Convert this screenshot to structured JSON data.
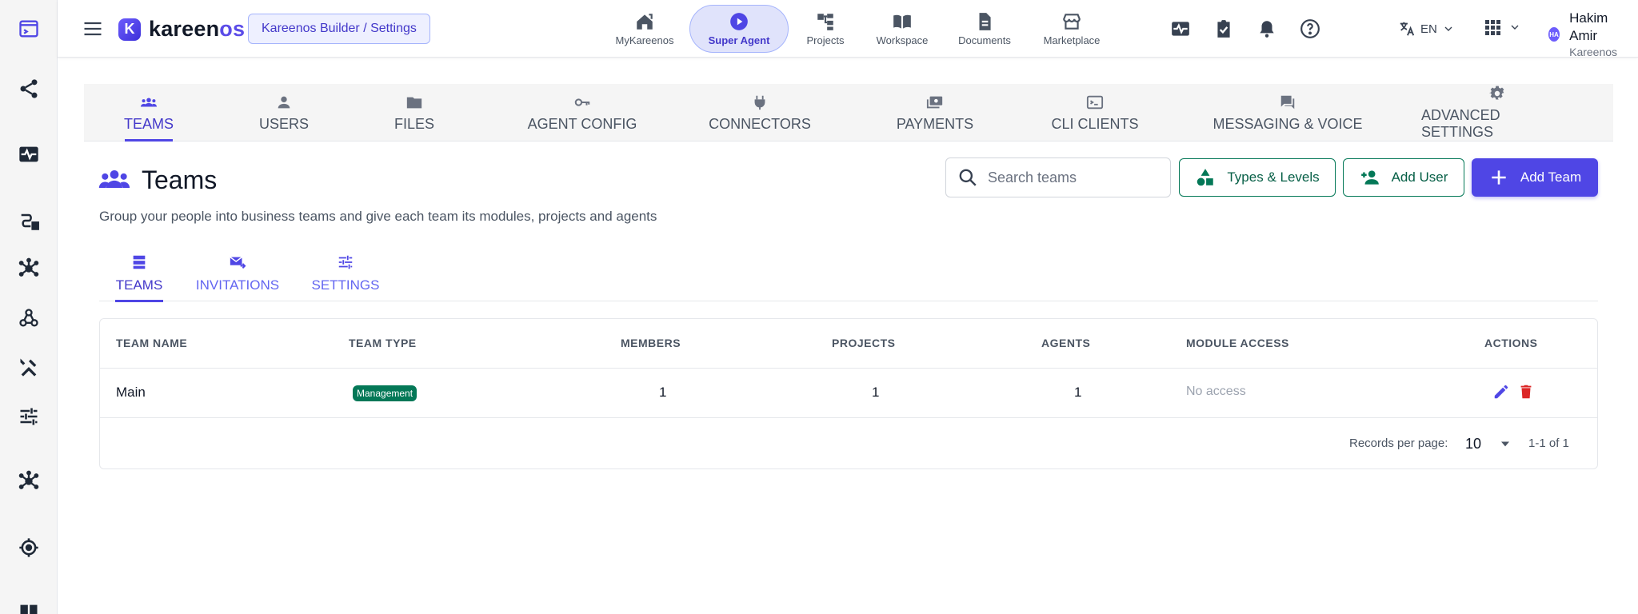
{
  "app": {
    "logo_letter": "K",
    "logo_name": "kareen",
    "logo_accent": "os",
    "breadcrumb": "Kareenos Builder / Settings"
  },
  "topnav": [
    {
      "label": "MyKareenos",
      "icon": "home-icon"
    },
    {
      "label": "Super Agent",
      "icon": "play-circle-icon",
      "active": true
    },
    {
      "label": "Projects",
      "icon": "hierarchy-icon"
    },
    {
      "label": "Workspace",
      "icon": "book-open-icon"
    },
    {
      "label": "Documents",
      "icon": "document-icon"
    },
    {
      "label": "Marketplace",
      "icon": "storefront-icon"
    }
  ],
  "header": {
    "language": "EN",
    "user_name": "Hakim Amir",
    "user_org": "Kareenos",
    "avatar_initials": "HA"
  },
  "main_tabs": [
    {
      "label": "TEAMS",
      "icon": "groups-icon",
      "active": true
    },
    {
      "label": "USERS",
      "icon": "person-icon"
    },
    {
      "label": "FILES",
      "icon": "folder-icon"
    },
    {
      "label": "AGENT CONFIG",
      "icon": "key-icon"
    },
    {
      "label": "CONNECTORS",
      "icon": "plug-icon"
    },
    {
      "label": "PAYMENTS",
      "icon": "payments-icon"
    },
    {
      "label": "CLI CLIENTS",
      "icon": "terminal-icon"
    },
    {
      "label": "MESSAGING & VOICE",
      "icon": "chat-icon"
    },
    {
      "label": "ADVANCED SETTINGS",
      "icon": "gear-icon"
    }
  ],
  "page": {
    "title": "Teams",
    "subtitle": "Group your people into business teams and give each team its modules, projects and agents",
    "search_placeholder": "Search teams",
    "btn_types": "Types & Levels",
    "btn_add_user": "Add User",
    "btn_add_team": "Add Team"
  },
  "sub_tabs": [
    {
      "label": "TEAMS",
      "icon": "list-icon",
      "active": true
    },
    {
      "label": "INVITATIONS",
      "icon": "mail-send-icon"
    },
    {
      "label": "SETTINGS",
      "icon": "tune-icon"
    }
  ],
  "table": {
    "columns": [
      "TEAM NAME",
      "TEAM TYPE",
      "MEMBERS",
      "PROJECTS",
      "AGENTS",
      "MODULE ACCESS",
      "ACTIONS"
    ],
    "rows": [
      {
        "name": "Main",
        "type": "Management",
        "members": "1",
        "projects": "1",
        "agents": "1",
        "module_access": "No access"
      }
    ],
    "records_per_page_label": "Records per page:",
    "records_per_page": "10",
    "range": "1-1 of 1"
  },
  "colors": {
    "primary": "#4f46e5",
    "success": "#047857",
    "danger": "#dc2626"
  }
}
